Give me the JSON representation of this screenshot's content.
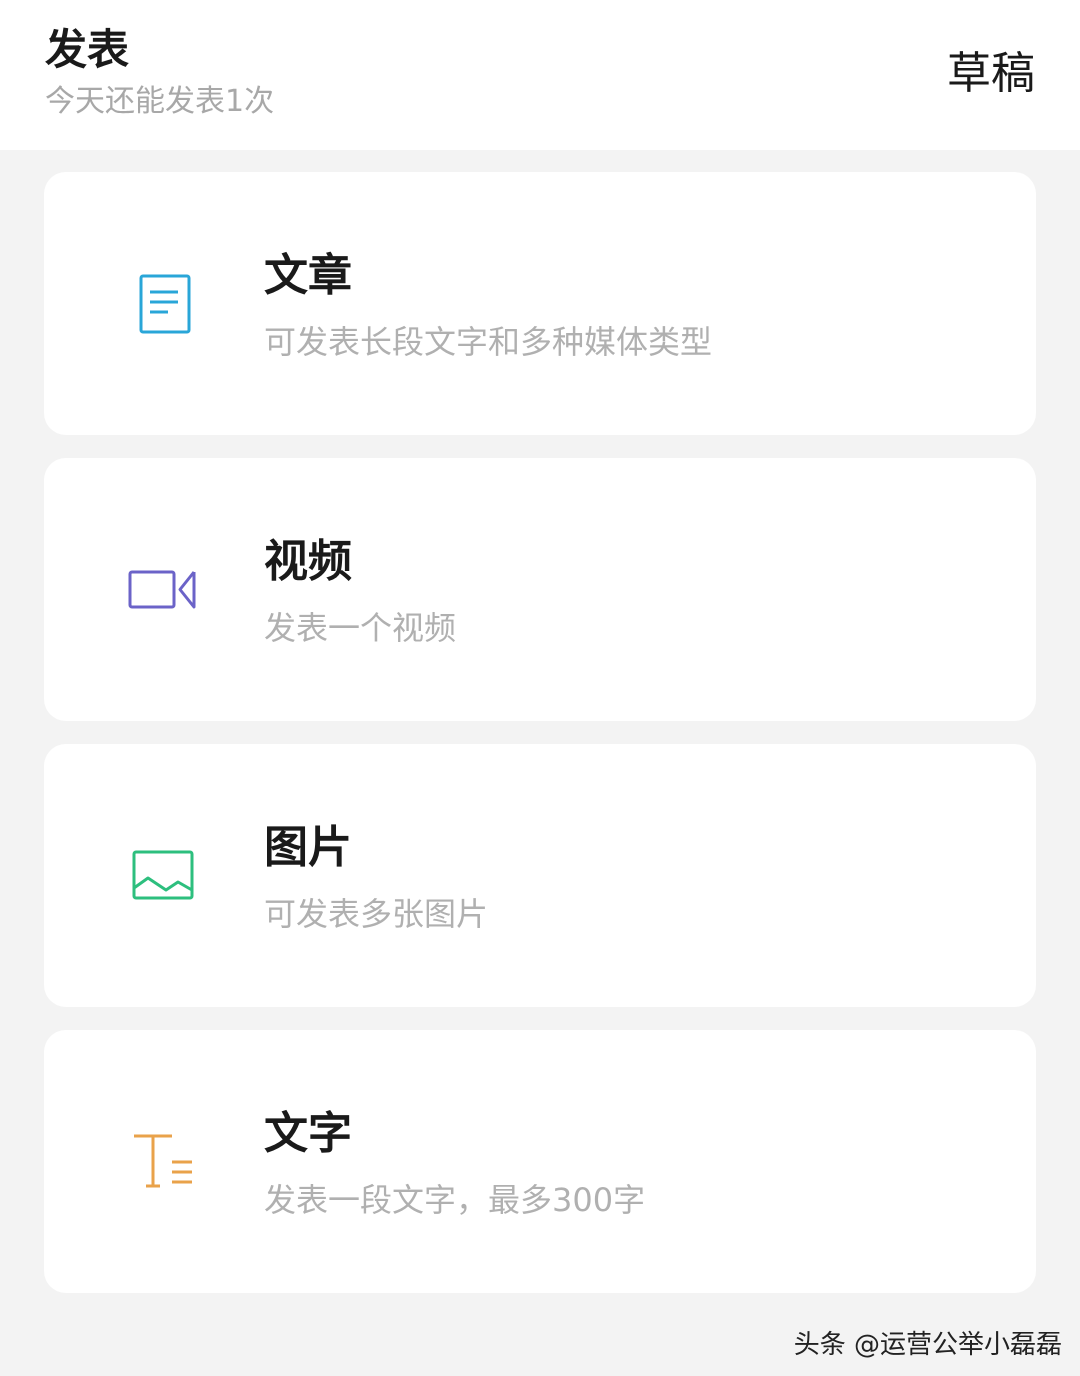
{
  "header": {
    "title": "发表",
    "subtitle": "今天还能发表1次",
    "drafts_label": "草稿"
  },
  "cards": [
    {
      "title": "文章",
      "description": "可发表长段文字和多种媒体类型",
      "icon": "article-icon",
      "color": "#29a6d8"
    },
    {
      "title": "视频",
      "description": "发表一个视频",
      "icon": "video-camera-icon",
      "color": "#6b63c8"
    },
    {
      "title": "图片",
      "description": "可发表多张图片",
      "icon": "image-icon",
      "color": "#2dbf7e"
    },
    {
      "title": "文字",
      "description": "发表一段文字，最多300字",
      "icon": "text-icon",
      "color": "#e9a24a"
    }
  ],
  "watermark": "头条 @运营公举小磊磊"
}
